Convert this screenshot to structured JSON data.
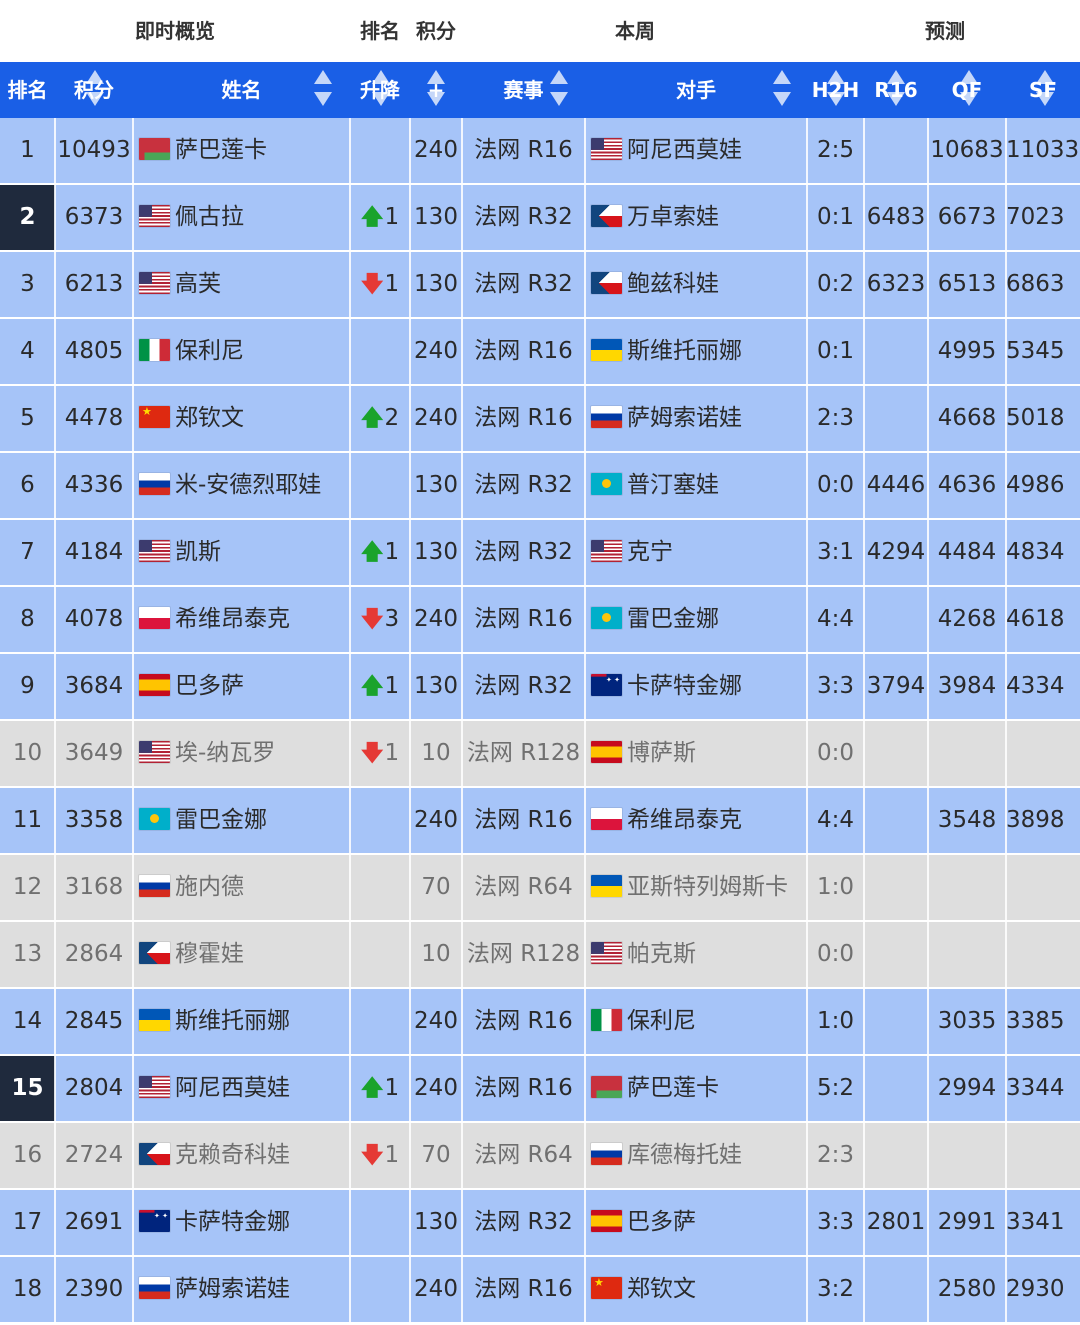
{
  "header": {
    "groups": [
      {
        "label": "即时概览"
      },
      {
        "label": "排名"
      },
      {
        "label": "积分"
      },
      {
        "label": "本周"
      },
      {
        "label": "预测"
      }
    ],
    "columns": {
      "rank": "排名",
      "points": "积分",
      "name": "姓名",
      "change": "升降",
      "plus": "+",
      "event": "赛事",
      "opponent": "对手",
      "h2h": "H2H",
      "r16": "R16",
      "qf": "QF",
      "sf": "SF"
    }
  },
  "rows": [
    {
      "rank": "1",
      "points": "10493",
      "flag": "BLR",
      "name": "萨巴莲卡",
      "change": "",
      "dir": "",
      "plus": "240",
      "event": "法网 R16",
      "oflag": "USA",
      "opponent": "阿尼西莫娃",
      "h2h": "2:5",
      "r16": "",
      "qf": "10683",
      "sf": "11033",
      "style": "blue",
      "highlight": false
    },
    {
      "rank": "2",
      "points": "6373",
      "flag": "USA",
      "name": "佩古拉",
      "change": "1",
      "dir": "up",
      "plus": "130",
      "event": "法网 R32",
      "oflag": "CZE",
      "opponent": "万卓索娃",
      "h2h": "0:1",
      "r16": "6483",
      "qf": "6673",
      "sf": "7023",
      "style": "blue",
      "highlight": true
    },
    {
      "rank": "3",
      "points": "6213",
      "flag": "USA",
      "name": "高芙",
      "change": "1",
      "dir": "down",
      "plus": "130",
      "event": "法网 R32",
      "oflag": "CZE",
      "opponent": "鲍兹科娃",
      "h2h": "0:2",
      "r16": "6323",
      "qf": "6513",
      "sf": "6863",
      "style": "blue",
      "highlight": false
    },
    {
      "rank": "4",
      "points": "4805",
      "flag": "ITA",
      "name": "保利尼",
      "change": "",
      "dir": "",
      "plus": "240",
      "event": "法网 R16",
      "oflag": "UKR",
      "opponent": "斯维托丽娜",
      "h2h": "0:1",
      "r16": "",
      "qf": "4995",
      "sf": "5345",
      "style": "blue",
      "highlight": false
    },
    {
      "rank": "5",
      "points": "4478",
      "flag": "CHN",
      "name": "郑钦文",
      "change": "2",
      "dir": "up",
      "plus": "240",
      "event": "法网 R16",
      "oflag": "RUS",
      "opponent": "萨姆索诺娃",
      "h2h": "2:3",
      "r16": "",
      "qf": "4668",
      "sf": "5018",
      "style": "blue",
      "highlight": false
    },
    {
      "rank": "6",
      "points": "4336",
      "flag": "RUS",
      "name": "米-安德烈耶娃",
      "change": "",
      "dir": "",
      "plus": "130",
      "event": "法网 R32",
      "oflag": "KAZ",
      "opponent": "普汀塞娃",
      "h2h": "0:0",
      "r16": "4446",
      "qf": "4636",
      "sf": "4986",
      "style": "blue",
      "highlight": false
    },
    {
      "rank": "7",
      "points": "4184",
      "flag": "USA",
      "name": "凯斯",
      "change": "1",
      "dir": "up",
      "plus": "130",
      "event": "法网 R32",
      "oflag": "USA",
      "opponent": "克宁",
      "h2h": "3:1",
      "r16": "4294",
      "qf": "4484",
      "sf": "4834",
      "style": "blue",
      "highlight": false
    },
    {
      "rank": "8",
      "points": "4078",
      "flag": "POL",
      "name": "希维昂泰克",
      "change": "3",
      "dir": "down",
      "plus": "240",
      "event": "法网 R16",
      "oflag": "KAZ",
      "opponent": "雷巴金娜",
      "h2h": "4:4",
      "r16": "",
      "qf": "4268",
      "sf": "4618",
      "style": "blue",
      "highlight": false
    },
    {
      "rank": "9",
      "points": "3684",
      "flag": "ESP",
      "name": "巴多萨",
      "change": "1",
      "dir": "up",
      "plus": "130",
      "event": "法网 R32",
      "oflag": "AUS",
      "opponent": "卡萨特金娜",
      "h2h": "3:3",
      "r16": "3794",
      "qf": "3984",
      "sf": "4334",
      "style": "blue",
      "highlight": false
    },
    {
      "rank": "10",
      "points": "3649",
      "flag": "USA",
      "name": "埃-纳瓦罗",
      "change": "1",
      "dir": "down",
      "plus": "10",
      "event": "法网 R128",
      "oflag": "ESP",
      "opponent": "博萨斯",
      "h2h": "0:0",
      "r16": "",
      "qf": "",
      "sf": "",
      "style": "gray",
      "highlight": false
    },
    {
      "rank": "11",
      "points": "3358",
      "flag": "KAZ",
      "name": "雷巴金娜",
      "change": "",
      "dir": "",
      "plus": "240",
      "event": "法网 R16",
      "oflag": "POL",
      "opponent": "希维昂泰克",
      "h2h": "4:4",
      "r16": "",
      "qf": "3548",
      "sf": "3898",
      "style": "blue",
      "highlight": false
    },
    {
      "rank": "12",
      "points": "3168",
      "flag": "RUS",
      "name": "施内德",
      "change": "",
      "dir": "",
      "plus": "70",
      "event": "法网 R64",
      "oflag": "UKR",
      "opponent": "亚斯特列姆斯卡",
      "h2h": "1:0",
      "r16": "",
      "qf": "",
      "sf": "",
      "style": "gray",
      "highlight": false
    },
    {
      "rank": "13",
      "points": "2864",
      "flag": "CZE",
      "name": "穆霍娃",
      "change": "",
      "dir": "",
      "plus": "10",
      "event": "法网 R128",
      "oflag": "USA",
      "opponent": "帕克斯",
      "h2h": "0:0",
      "r16": "",
      "qf": "",
      "sf": "",
      "style": "gray",
      "highlight": false
    },
    {
      "rank": "14",
      "points": "2845",
      "flag": "UKR",
      "name": "斯维托丽娜",
      "change": "",
      "dir": "",
      "plus": "240",
      "event": "法网 R16",
      "oflag": "ITA",
      "opponent": "保利尼",
      "h2h": "1:0",
      "r16": "",
      "qf": "3035",
      "sf": "3385",
      "style": "blue",
      "highlight": false
    },
    {
      "rank": "15",
      "points": "2804",
      "flag": "USA",
      "name": "阿尼西莫娃",
      "change": "1",
      "dir": "up",
      "plus": "240",
      "event": "法网 R16",
      "oflag": "BLR",
      "opponent": "萨巴莲卡",
      "h2h": "5:2",
      "r16": "",
      "qf": "2994",
      "sf": "3344",
      "style": "blue",
      "highlight": true
    },
    {
      "rank": "16",
      "points": "2724",
      "flag": "CZE",
      "name": "克赖奇科娃",
      "change": "1",
      "dir": "down",
      "plus": "70",
      "event": "法网 R64",
      "oflag": "RUS",
      "opponent": "库德梅托娃",
      "h2h": "2:3",
      "r16": "",
      "qf": "",
      "sf": "",
      "style": "gray",
      "highlight": false
    },
    {
      "rank": "17",
      "points": "2691",
      "flag": "AUS",
      "name": "卡萨特金娜",
      "change": "",
      "dir": "",
      "plus": "130",
      "event": "法网 R32",
      "oflag": "ESP",
      "opponent": "巴多萨",
      "h2h": "3:3",
      "r16": "2801",
      "qf": "2991",
      "sf": "3341",
      "style": "blue",
      "highlight": false
    },
    {
      "rank": "18",
      "points": "2390",
      "flag": "RUS",
      "name": "萨姆索诺娃",
      "change": "",
      "dir": "",
      "plus": "240",
      "event": "法网 R16",
      "oflag": "CHN",
      "opponent": "郑钦文",
      "h2h": "3:2",
      "r16": "",
      "qf": "2580",
      "sf": "2930",
      "style": "blue",
      "highlight": false
    }
  ]
}
